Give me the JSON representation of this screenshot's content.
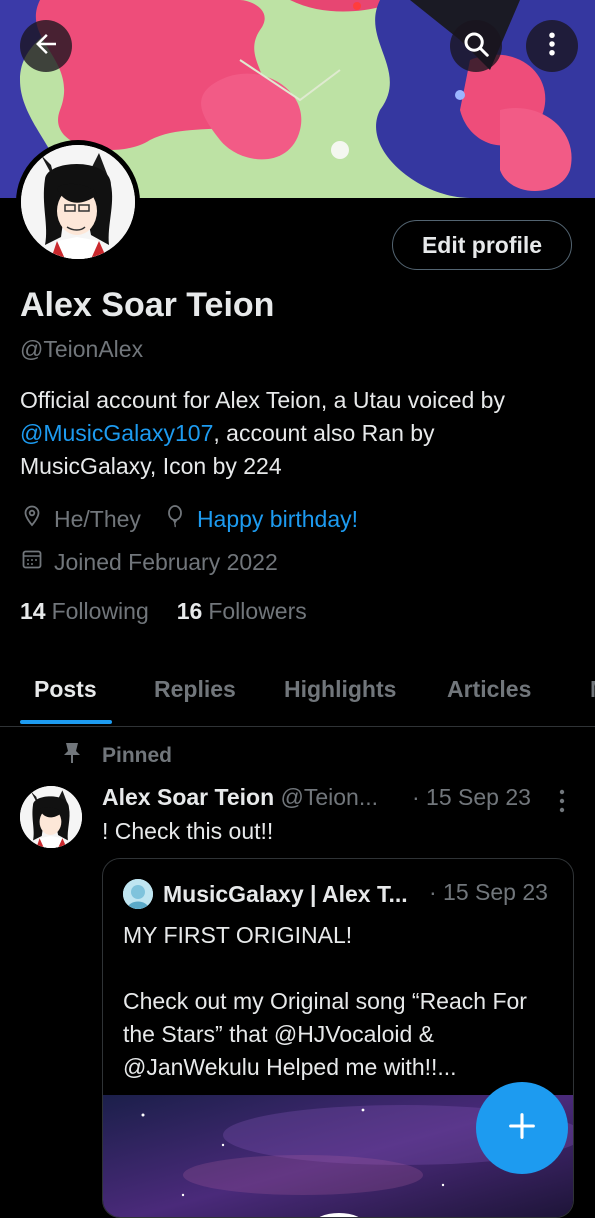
{
  "header": {
    "back_icon": "back-arrow-icon",
    "search_icon": "search-icon",
    "more_icon": "more-vertical-icon"
  },
  "profile": {
    "display_name": "Alex Soar Teion",
    "handle": "@TeionAlex",
    "edit_button": "Edit profile",
    "bio_part1": "Official account for Alex Teion, a Utau voiced by ",
    "bio_mention": "@MusicGalaxy107",
    "bio_part2": ", account also Ran by MusicGalaxy, Icon by 224",
    "pronouns": "He/They",
    "birthday": "Happy birthday!",
    "joined": "Joined February 2022",
    "following_count": "14",
    "following_label": "Following",
    "followers_count": "16",
    "followers_label": "Followers"
  },
  "tabs": [
    {
      "label": "Posts"
    },
    {
      "label": "Replies"
    },
    {
      "label": "Highlights"
    },
    {
      "label": "Articles"
    },
    {
      "label": "M"
    }
  ],
  "pinned_post": {
    "pinned_label": "Pinned",
    "author_name": "Alex Soar Teion",
    "author_handle": "@Teion...",
    "date": "· 15 Sep 23",
    "text": "! Check this out!!",
    "quote": {
      "author": "MusicGalaxy | Alex T...",
      "date": "· 15 Sep 23",
      "text": "MY FIRST ORIGINAL!\n\nCheck out my Original song “Reach For the Stars” that @HJVocaloid & @JanWekulu Helped me with!!..."
    }
  },
  "colors": {
    "accent": "#1d9bf0",
    "background": "#000000",
    "text_primary": "#e7e9ea",
    "text_secondary": "#71767b"
  }
}
